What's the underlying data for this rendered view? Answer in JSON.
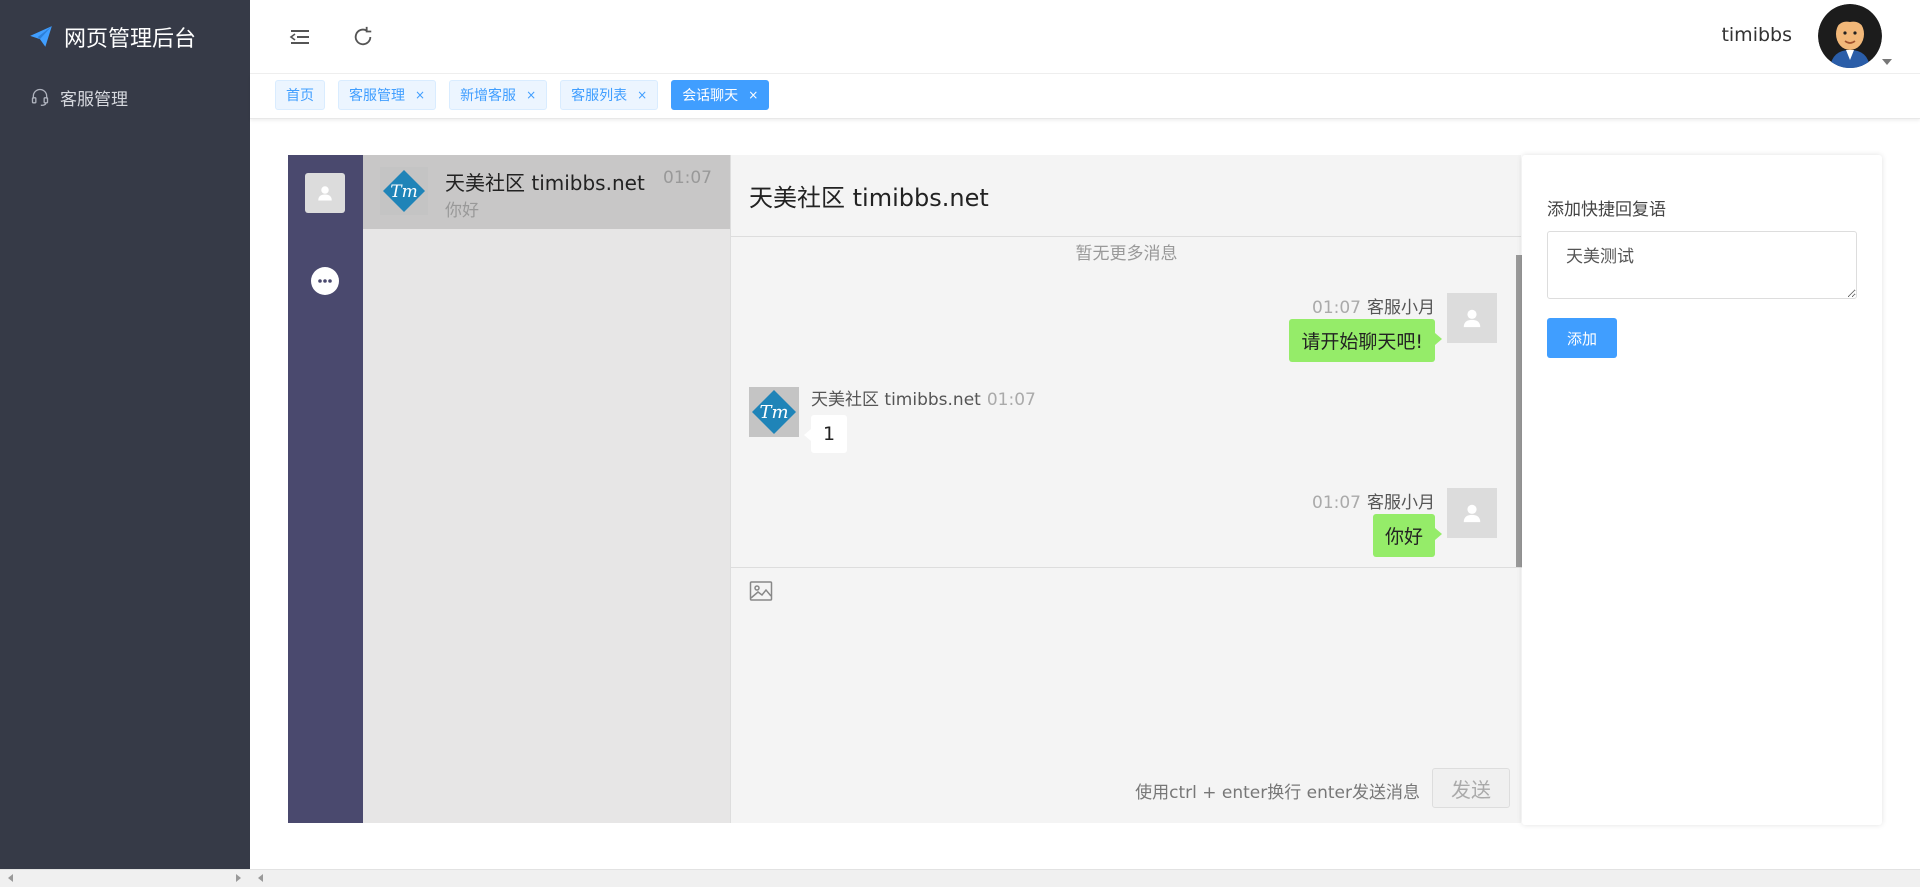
{
  "app": {
    "title": "网页管理后台"
  },
  "sidebar": {
    "items": [
      {
        "label": "客服管理"
      }
    ]
  },
  "header": {
    "username": "timibbs"
  },
  "tabs": [
    {
      "label": "首页",
      "closable": false,
      "active": false
    },
    {
      "label": "客服管理",
      "closable": true,
      "active": false
    },
    {
      "label": "新增客服",
      "closable": true,
      "active": false
    },
    {
      "label": "客服列表",
      "closable": true,
      "active": false
    },
    {
      "label": "会话聊天",
      "closable": true,
      "active": true
    }
  ],
  "tab_close_glyph": "×",
  "conversation_list": [
    {
      "name": "天美社区 timibbs.net",
      "time": "01:07",
      "last_message": "你好"
    }
  ],
  "chat": {
    "title": "天美社区 timibbs.net",
    "no_more": "暂无更多消息",
    "messages": [
      {
        "side": "right",
        "time": "01:07",
        "sender": "客服小月",
        "text": "请开始聊天吧!"
      },
      {
        "side": "left",
        "time": "01:07",
        "sender": "天美社区 timibbs.net",
        "text": "1"
      },
      {
        "side": "right",
        "time": "01:07",
        "sender": "客服小月",
        "text": "你好"
      }
    ],
    "hint": "使用ctrl + enter换行 enter发送消息",
    "send_label": "发送"
  },
  "quick_reply": {
    "title": "添加快捷回复语",
    "textarea_value": "天美测试",
    "add_label": "添加"
  },
  "colors": {
    "sidebar_bg": "#363a47",
    "accent": "#409eff",
    "rail_bg": "#4a496e",
    "bubble_green": "#95ec69"
  },
  "icons": {
    "brand": "paper-plane-icon",
    "sidebar": "headset-icon",
    "menu": "menu-fold-icon",
    "refresh": "refresh-icon",
    "rail_user": "user-icon",
    "rail_chat": "chat-bubble-icon",
    "image": "image-icon"
  }
}
